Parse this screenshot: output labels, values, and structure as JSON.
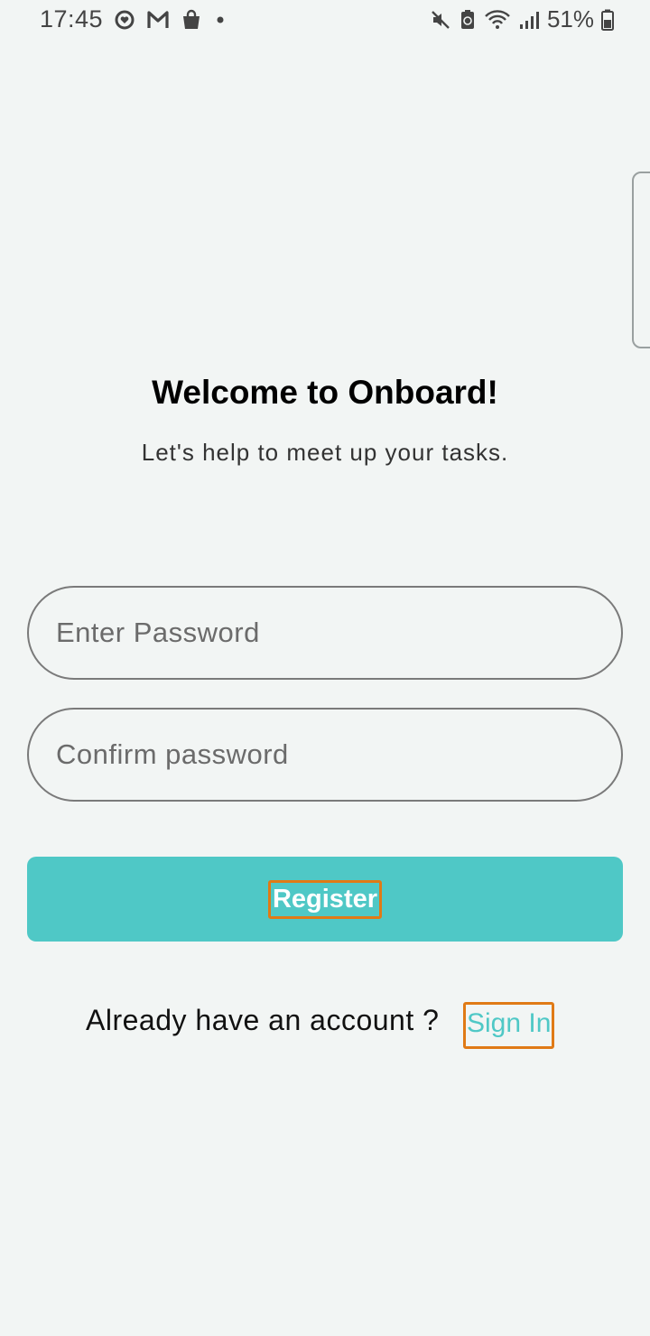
{
  "status_bar": {
    "time": "17:45",
    "battery": "51%",
    "icons_left": [
      "circle-heart-icon",
      "gmail-icon",
      "shopping-bag-icon",
      "dot-icon"
    ],
    "icons_right": [
      "mute-icon",
      "battery-saver-icon",
      "wifi-icon",
      "signal-icon",
      "battery-icon"
    ]
  },
  "header": {
    "title": "Welcome to Onboard!",
    "subtitle": "Let's help to meet up your tasks."
  },
  "form": {
    "password_placeholder": "Enter Password",
    "confirm_placeholder": "Confirm password",
    "register_label": "Register"
  },
  "footer": {
    "prompt": "Already have an account ?",
    "signin_label": "Sign In"
  },
  "colors": {
    "accent": "#4fc8c6",
    "background": "#f2f5f4",
    "highlight_border": "#e07a16"
  }
}
